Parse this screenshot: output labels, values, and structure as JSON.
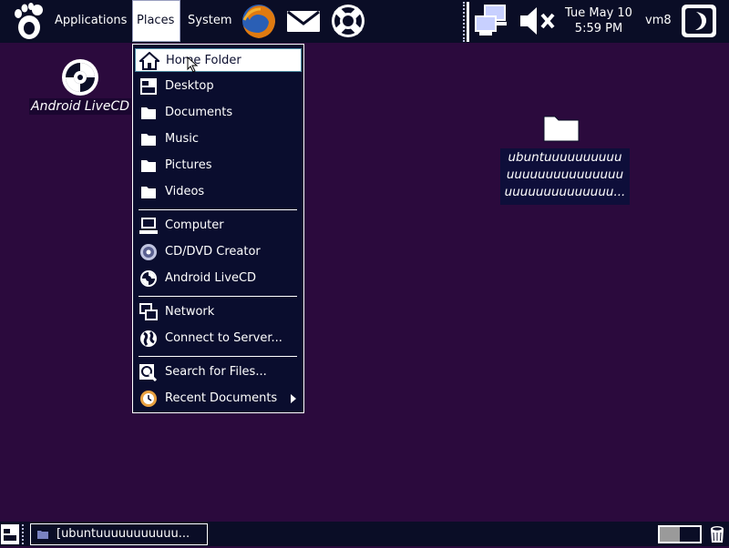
{
  "top_panel": {
    "menus": [
      {
        "label": "Applications"
      },
      {
        "label": "Places"
      },
      {
        "label": "System"
      }
    ],
    "launchers": [
      "firefox-icon",
      "mail-icon",
      "help-lifebuoy-icon"
    ],
    "tray": [
      "network-icon",
      "volume-muted-icon"
    ],
    "clock": {
      "date": "Tue May 10",
      "time": "5:59 PM"
    },
    "user": "vm8",
    "shutdown_icon": "logout-moon-icon"
  },
  "desktop": {
    "android_icon": {
      "label": "Android LiveCD",
      "icon": "cd-disc-icon"
    },
    "ubuntu_folder": {
      "label_lines": "ubuntuuuuuuuuuu\nuuuuuuuuuuuuuuu\nuuuuuuuuuuuuuu...",
      "icon": "folder-icon"
    }
  },
  "places_menu": {
    "items": [
      {
        "label": "Home Folder",
        "icon": "home-icon"
      },
      {
        "label": "Desktop",
        "icon": "desktop-icon"
      },
      {
        "label": "Documents",
        "icon": "folder-icon"
      },
      {
        "label": "Music",
        "icon": "folder-icon"
      },
      {
        "label": "Pictures",
        "icon": "folder-icon"
      },
      {
        "label": "Videos",
        "icon": "folder-icon"
      },
      {
        "label": "Computer",
        "icon": "computer-icon"
      },
      {
        "label": "CD/DVD Creator",
        "icon": "cd-burner-icon"
      },
      {
        "label": "Android LiveCD",
        "icon": "cd-disc-icon"
      },
      {
        "label": "Network",
        "icon": "network-icon"
      },
      {
        "label": "Connect to Server...",
        "icon": "globe-icon"
      },
      {
        "label": "Search for Files...",
        "icon": "search-icon"
      },
      {
        "label": "Recent Documents",
        "icon": "clock-icon"
      }
    ]
  },
  "bottom_panel": {
    "task": {
      "label": "[ubuntuuuuuuuuuuu..."
    },
    "show_desktop_icon": "show-desktop-icon",
    "trash_icon": "trash-icon"
  },
  "colors": {
    "desktop_bg": "#2b0a3d",
    "panel_bg": "#0a0d26",
    "menu_bg": "#0a0d2e"
  }
}
